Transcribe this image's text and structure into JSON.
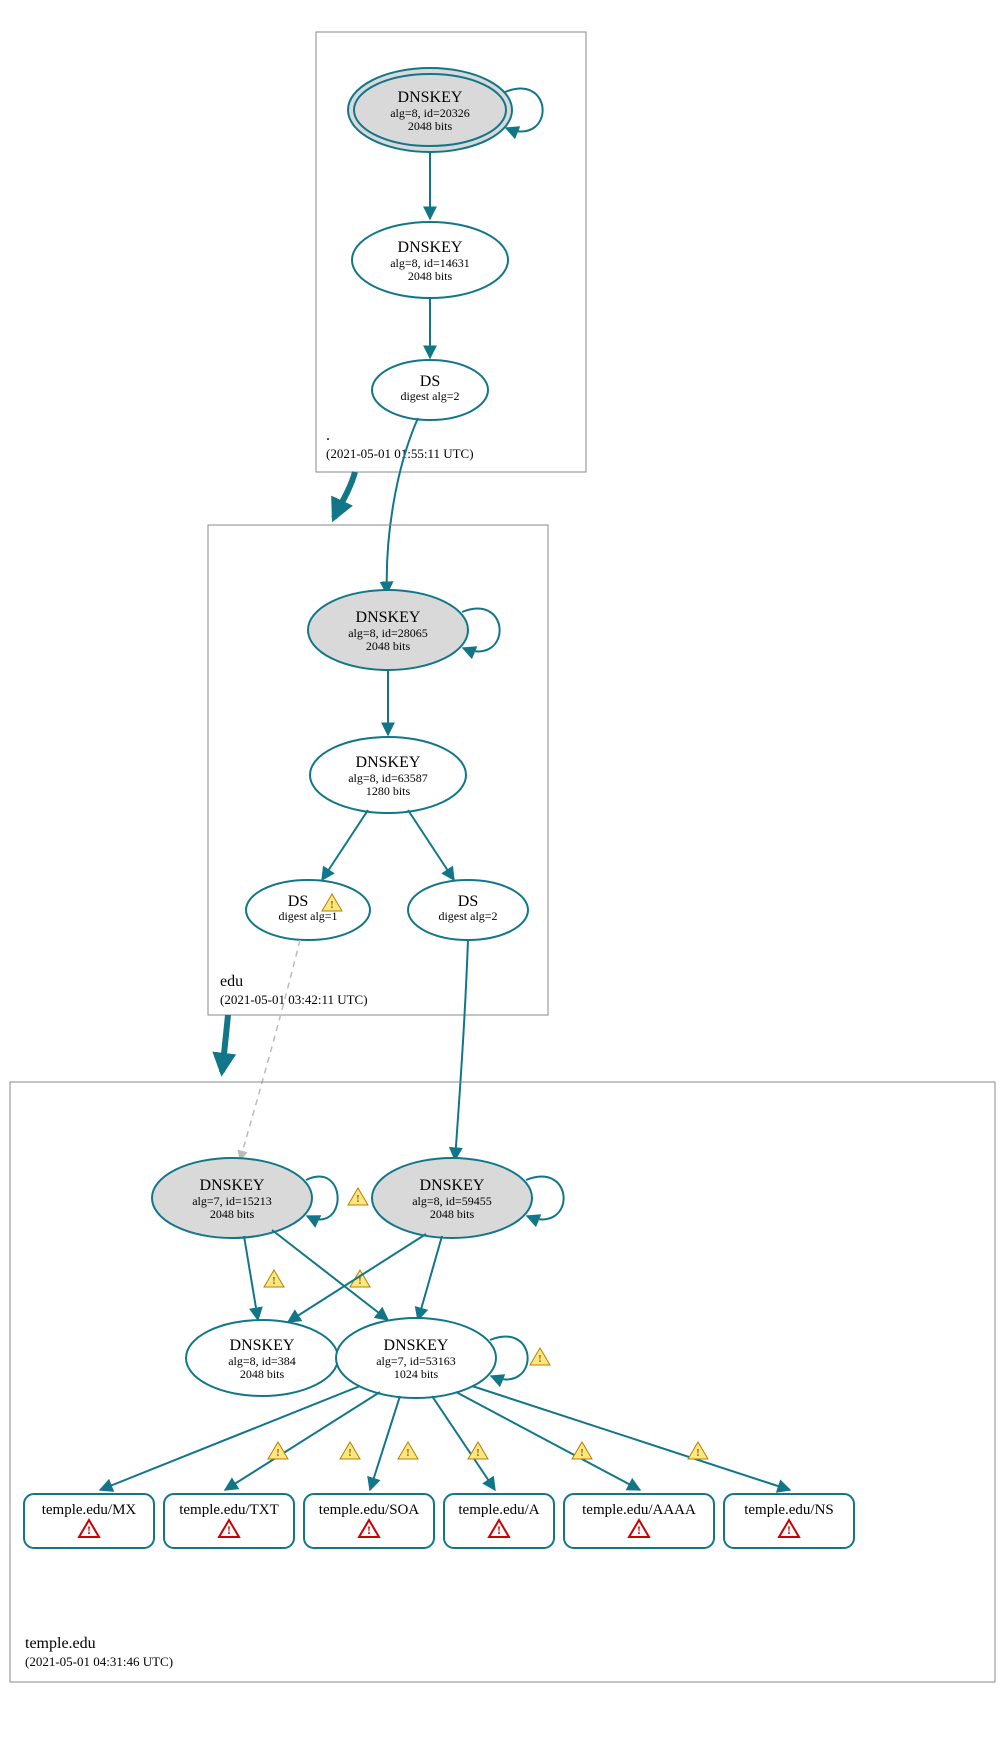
{
  "zones": {
    "root": {
      "label": ".",
      "timestamp": "(2021-05-01 01:55:11 UTC)"
    },
    "edu": {
      "label": "edu",
      "timestamp": "(2021-05-01 03:42:11 UTC)"
    },
    "temple": {
      "label": "temple.edu",
      "timestamp": "(2021-05-01 04:31:46 UTC)"
    }
  },
  "nodes": {
    "root_ksk": {
      "title": "DNSKEY",
      "line1": "alg=8, id=20326",
      "line2": "2048 bits"
    },
    "root_zsk": {
      "title": "DNSKEY",
      "line1": "alg=8, id=14631",
      "line2": "2048 bits"
    },
    "root_ds": {
      "title": "DS",
      "line1": "digest alg=2"
    },
    "edu_ksk": {
      "title": "DNSKEY",
      "line1": "alg=8, id=28065",
      "line2": "2048 bits"
    },
    "edu_zsk": {
      "title": "DNSKEY",
      "line1": "alg=8, id=63587",
      "line2": "1280 bits"
    },
    "edu_ds1": {
      "title": "DS",
      "line1": "digest alg=1"
    },
    "edu_ds2": {
      "title": "DS",
      "line1": "digest alg=2"
    },
    "t_ksk_a": {
      "title": "DNSKEY",
      "line1": "alg=7, id=15213",
      "line2": "2048 bits"
    },
    "t_ksk_b": {
      "title": "DNSKEY",
      "line1": "alg=8, id=59455",
      "line2": "2048 bits"
    },
    "t_zsk_a": {
      "title": "DNSKEY",
      "line1": "alg=8, id=384",
      "line2": "2048 bits"
    },
    "t_zsk_b": {
      "title": "DNSKEY",
      "line1": "alg=7, id=53163",
      "line2": "1024 bits"
    }
  },
  "rrsets": {
    "mx": {
      "label": "temple.edu/MX"
    },
    "txt": {
      "label": "temple.edu/TXT"
    },
    "soa": {
      "label": "temple.edu/SOA"
    },
    "a": {
      "label": "temple.edu/A"
    },
    "aaaa": {
      "label": "temple.edu/AAAA"
    },
    "ns": {
      "label": "temple.edu/NS"
    }
  },
  "icons": {
    "warn_glyph": "!",
    "err_glyph": "!"
  }
}
